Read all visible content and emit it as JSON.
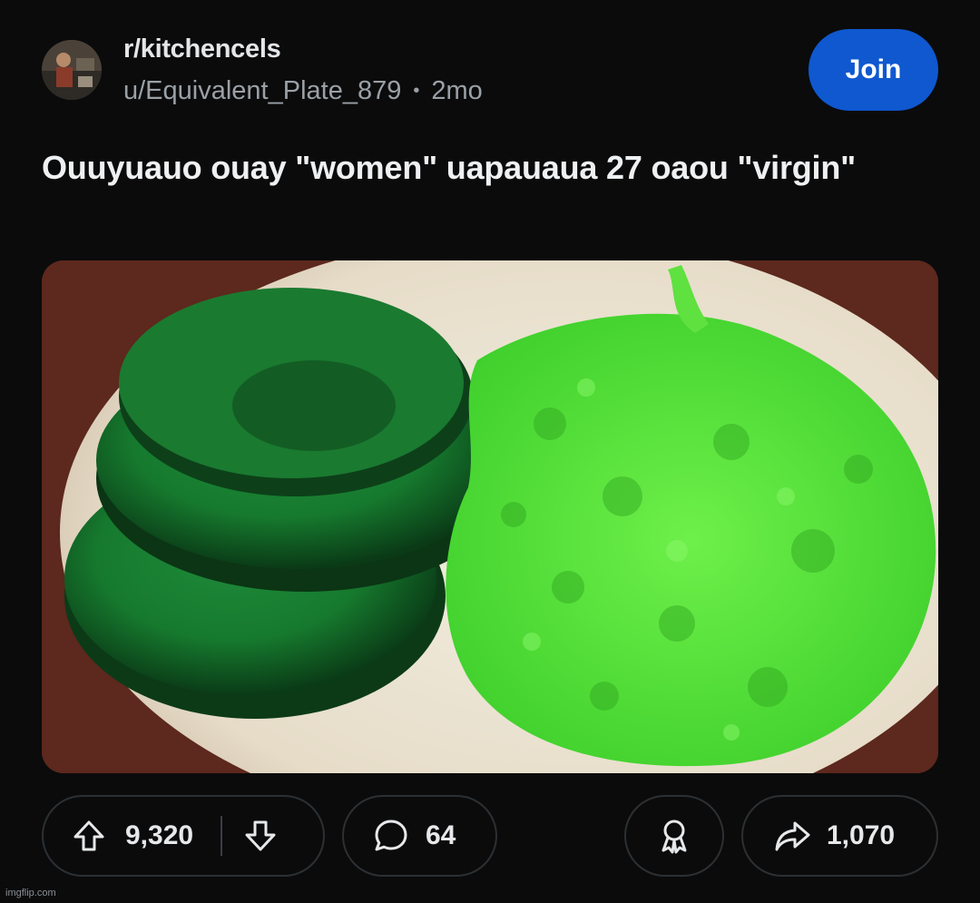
{
  "post": {
    "subreddit": "r/kitchencels",
    "author": "u/Equivalent_Plate_879",
    "separator": "•",
    "age": "2mo",
    "join_label": "Join",
    "title": "Ouuyuauo ouay \"women\" uapauaua 27 oaou \"virgin\""
  },
  "actions": {
    "upvotes": "9,320",
    "comments": "64",
    "shares": "1,070"
  },
  "icons": {
    "upvote": "upvote-arrow-icon",
    "downvote": "downvote-arrow-icon",
    "comment": "comment-bubble-icon",
    "award": "award-ribbon-icon",
    "share": "share-arrow-icon"
  },
  "watermark": "imgflip.com",
  "colors": {
    "background": "#0b0b0c",
    "join_button": "#0f58cf",
    "pill_border": "#2c3033"
  }
}
